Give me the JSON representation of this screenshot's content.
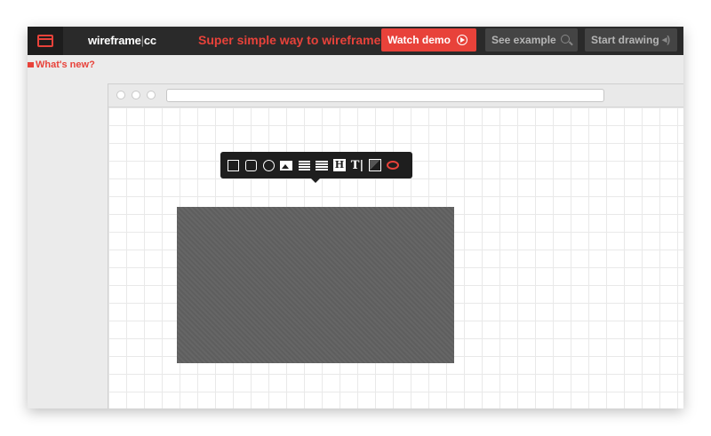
{
  "header": {
    "brand_name": "wireframe",
    "brand_sep": "|",
    "brand_suffix": "cc",
    "tagline": "Super simple way to wireframe",
    "watch_demo_label": "Watch demo",
    "see_example_label": "See example",
    "start_drawing_label": "Start drawing",
    "start_drawing_icon_glyph": "◂)"
  },
  "subbar": {
    "whats_new_label": "What's new?"
  },
  "colors": {
    "accent": "#e8423a",
    "topbar": "#2a2a2a",
    "shape_fill": "#666666"
  },
  "toolbar": {
    "tools": [
      {
        "name": "rectangle-tool",
        "icon": "square-icon"
      },
      {
        "name": "rounded-rectangle-tool",
        "icon": "rounded-square-icon"
      },
      {
        "name": "circle-tool",
        "icon": "circle-icon"
      },
      {
        "name": "image-tool",
        "icon": "image-icon"
      },
      {
        "name": "paragraph-tool",
        "icon": "paragraph-icon"
      },
      {
        "name": "list-tool",
        "icon": "lines-icon"
      },
      {
        "name": "heading-tool",
        "icon": "heading-icon"
      },
      {
        "name": "text-tool",
        "icon": "text-cursor-icon"
      },
      {
        "name": "box-tool",
        "icon": "box-icon"
      },
      {
        "name": "comment-tool",
        "icon": "speech-bubble-icon"
      }
    ],
    "heading_glyph": "H",
    "text_glyph": "T|"
  }
}
